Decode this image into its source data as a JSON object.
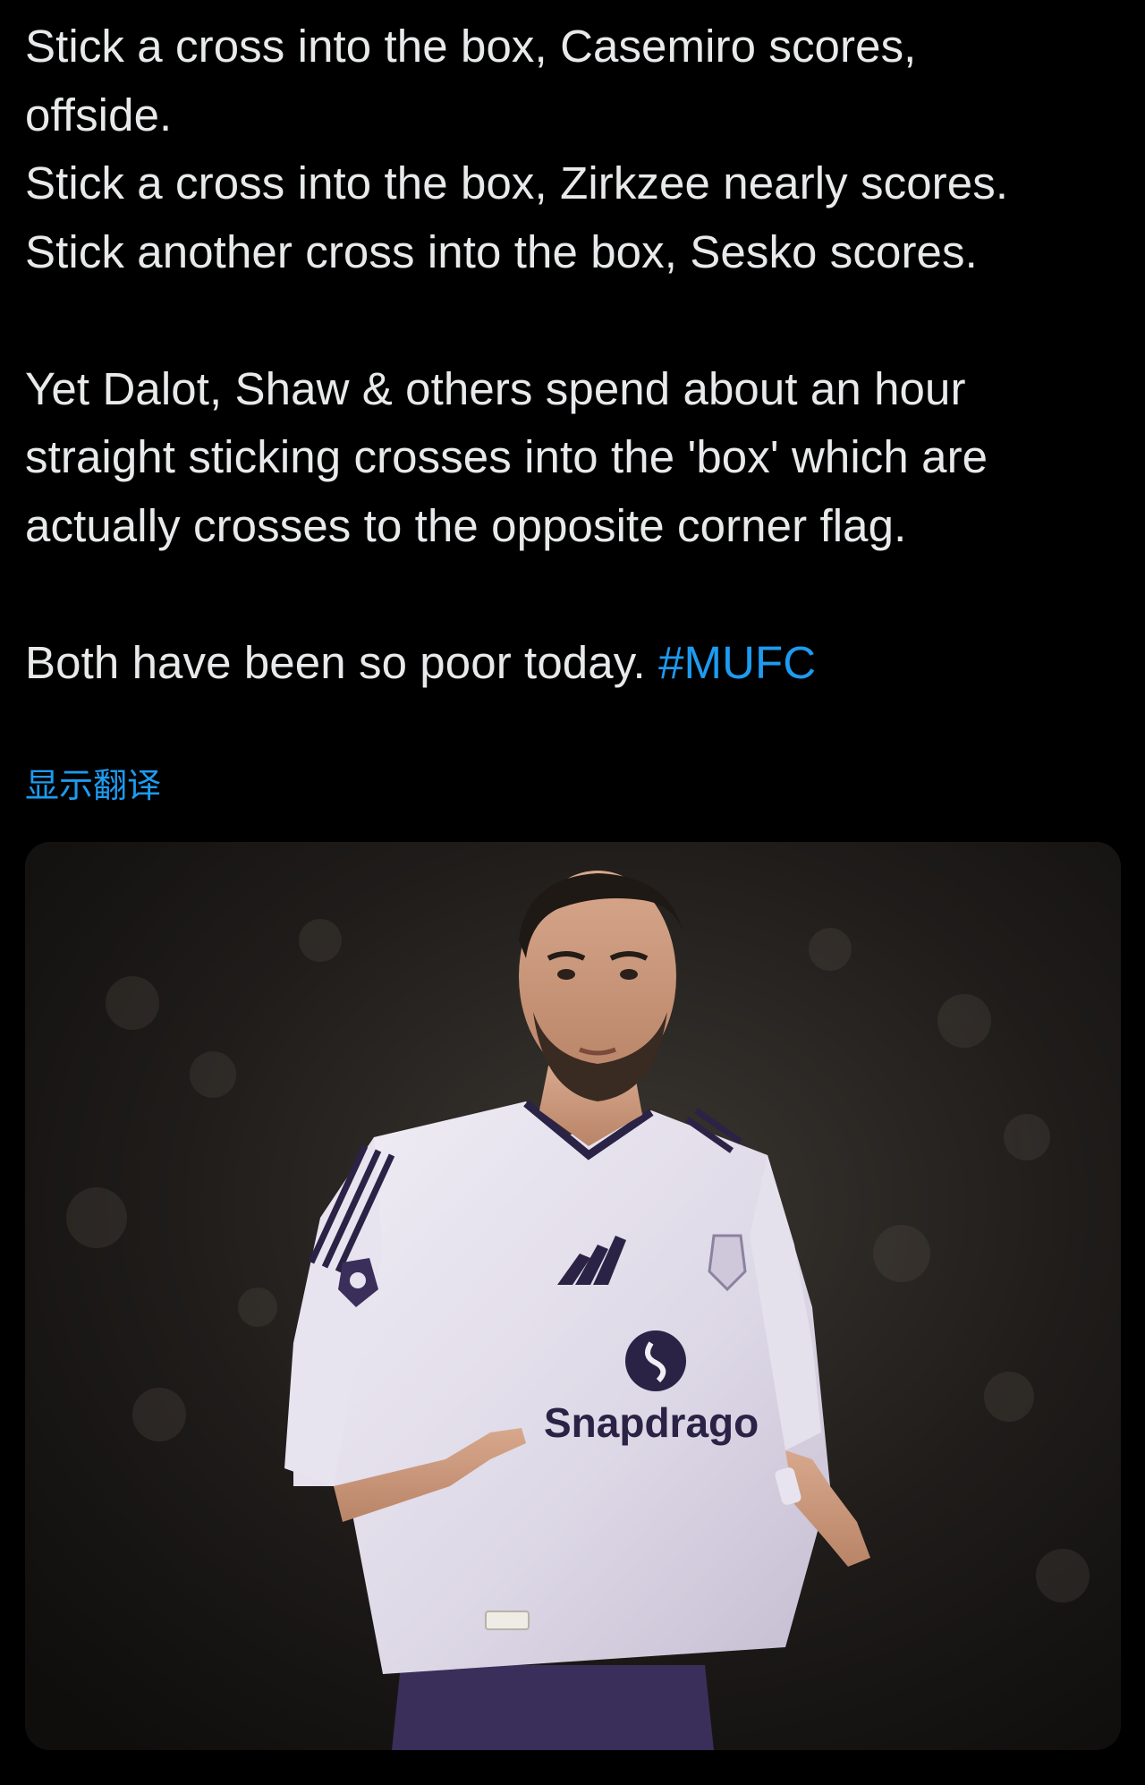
{
  "tweet": {
    "lines": [
      "Stick a cross into the box, Casemiro scores,",
      "offside.",
      "Stick a cross into the box, Zirkzee nearly scores.",
      "Stick another cross into the box, Sesko scores.",
      "Yet Dalot, Shaw & others spend about an hour",
      "straight sticking crosses into the 'box' which are",
      "actually crosses to the opposite corner flag.",
      "Both have been so poor today. "
    ],
    "hashtag": "#MUFC",
    "translate_label": "显示翻译"
  },
  "media": {
    "alt": "Footballer in a white kit",
    "sponsor_text": "Snapdrago"
  },
  "colors": {
    "background": "#000000",
    "text": "#e7e9ea",
    "link": "#1d9bf0"
  }
}
